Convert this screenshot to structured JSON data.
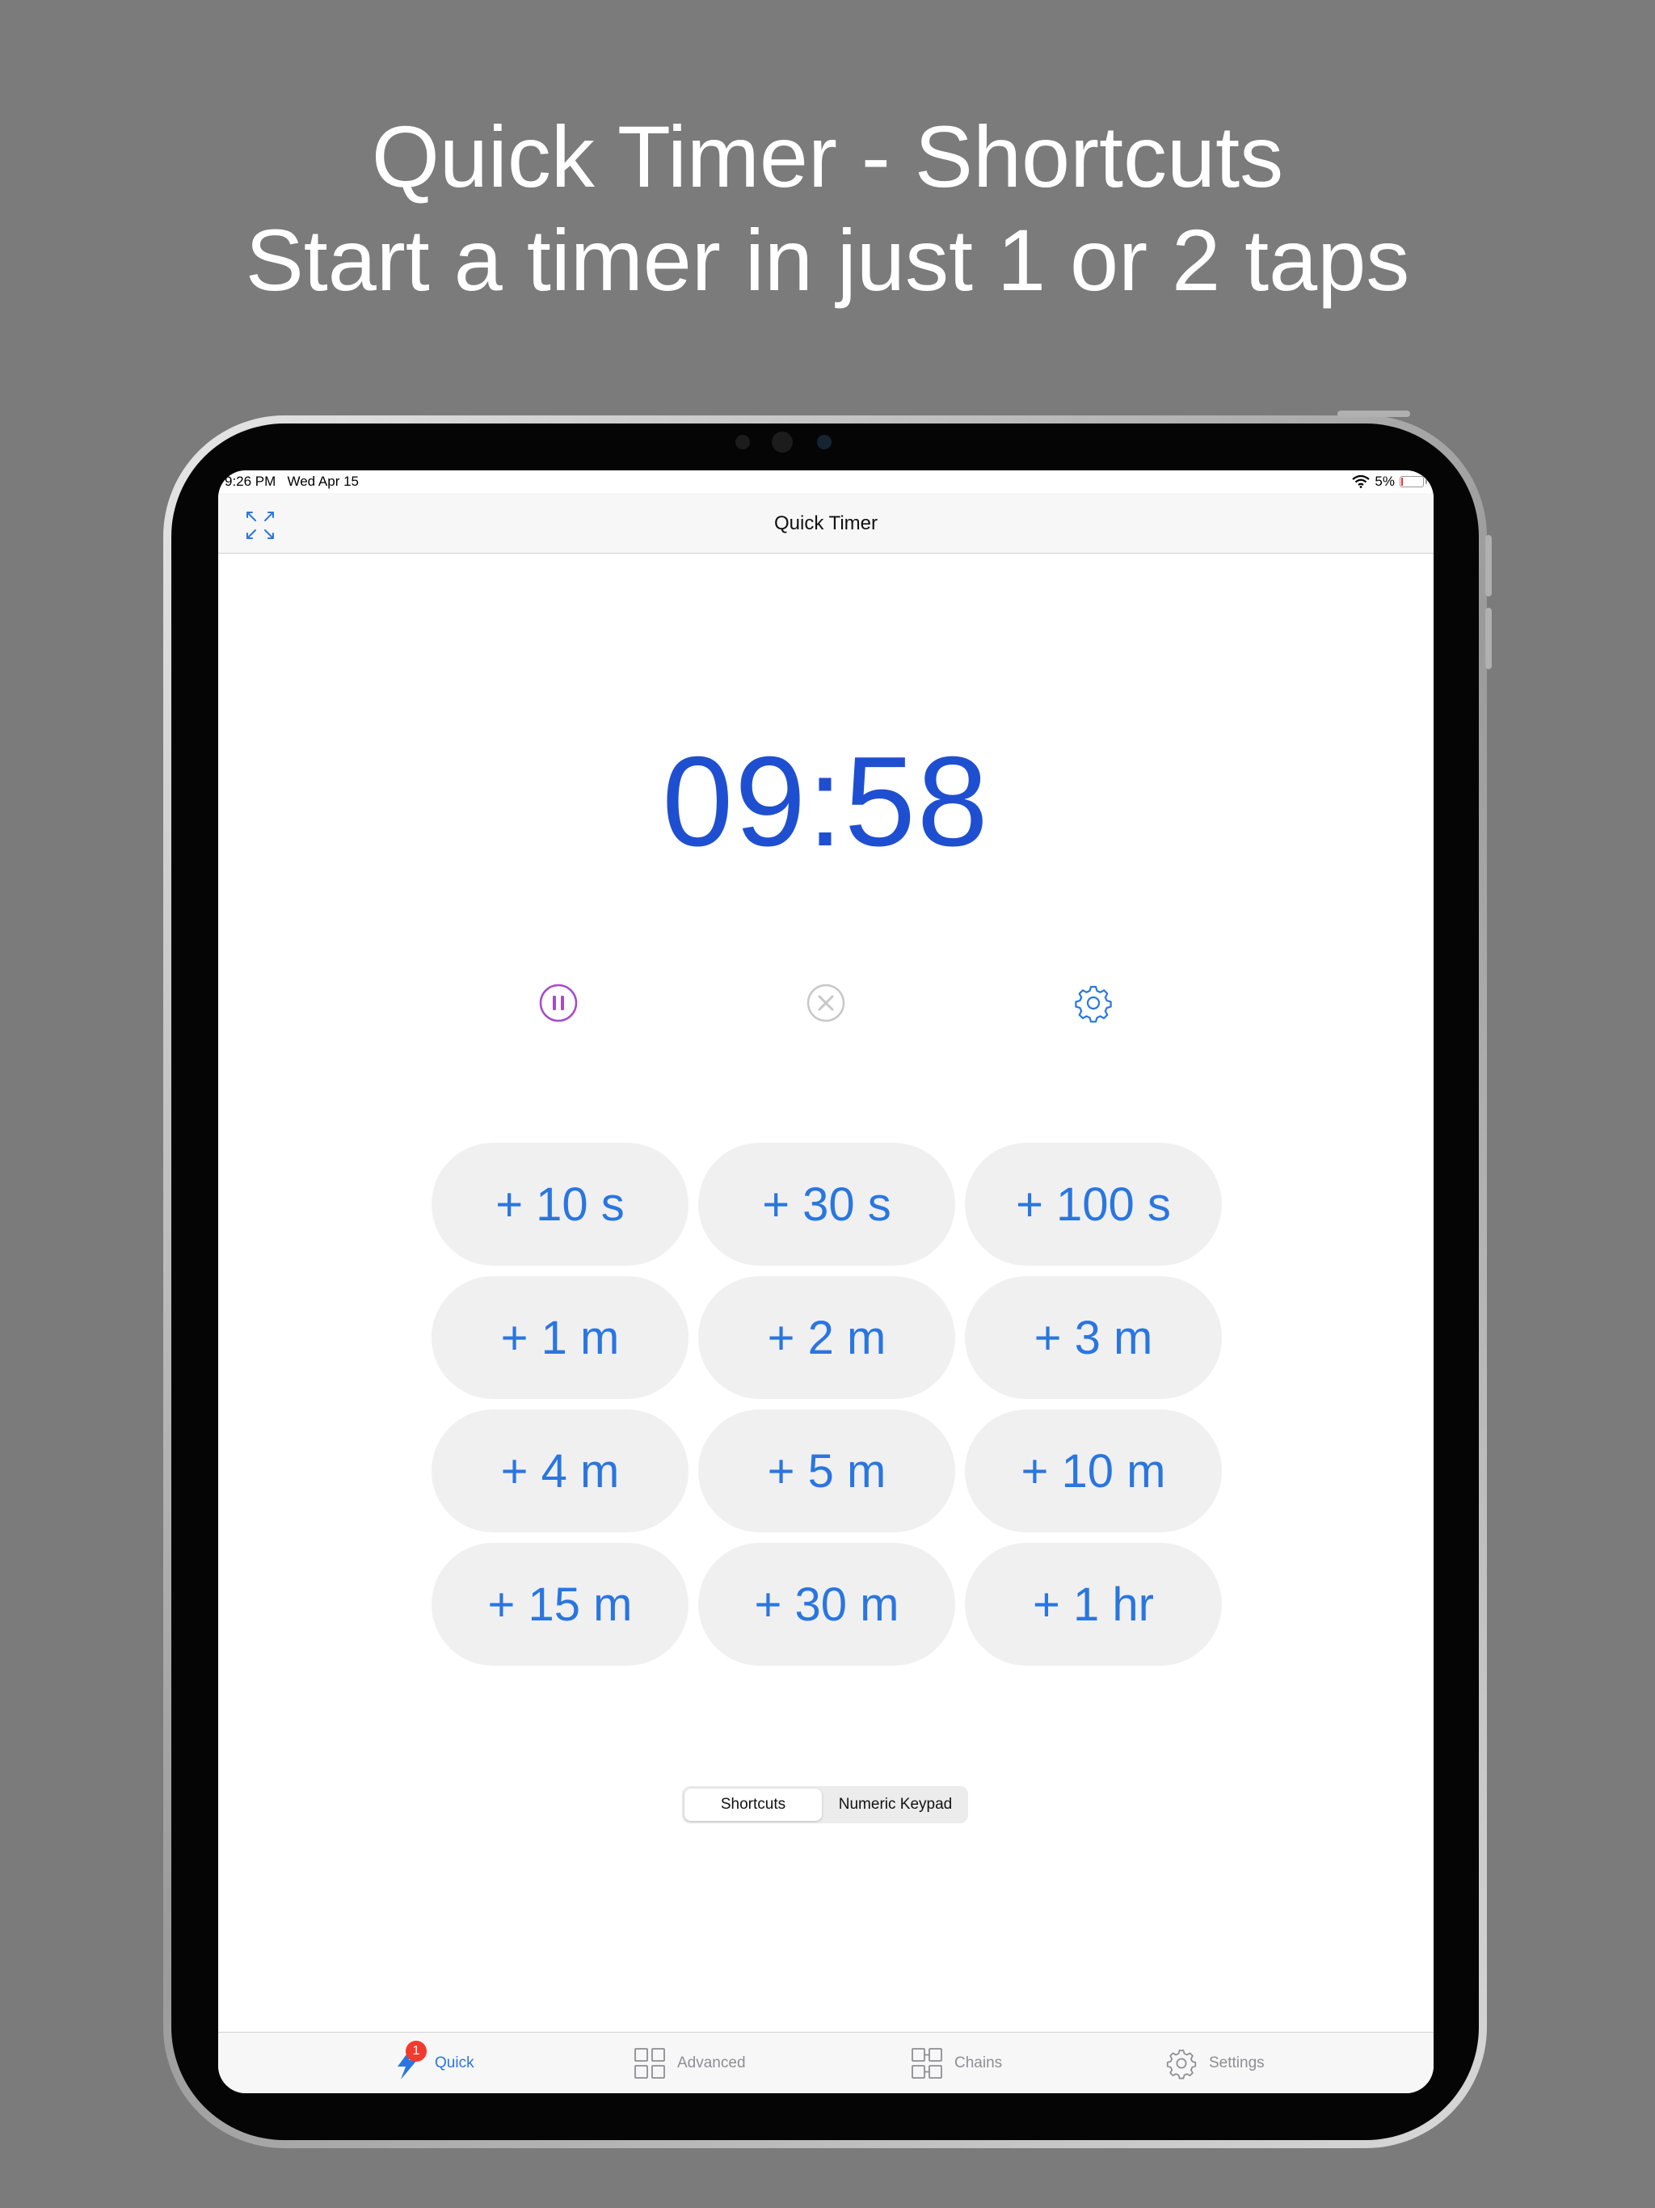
{
  "headline": {
    "line1": "Quick Timer - Shortcuts",
    "line2": "Start a timer in just 1 or 2 taps"
  },
  "status_bar": {
    "time": "9:26 PM",
    "date": "Wed Apr 15",
    "battery": "5%"
  },
  "nav": {
    "title": "Quick Timer"
  },
  "timer": {
    "display": "09:58"
  },
  "controls": {
    "pause_color": "#a64cc6",
    "cancel_color": "#c8c8c8",
    "settings_color": "#2a76e0"
  },
  "shortcuts": [
    "+ 10 s",
    "+ 30 s",
    "+ 100 s",
    "+ 1 m",
    "+ 2 m",
    "+ 3 m",
    "+ 4 m",
    "+ 5 m",
    "+ 10 m",
    "+ 15 m",
    "+ 30 m",
    "+ 1 hr"
  ],
  "segmented": {
    "selected": "Shortcuts",
    "other": "Numeric Keypad"
  },
  "tabs": {
    "quick": "Quick",
    "quick_badge": "1",
    "advanced": "Advanced",
    "chains": "Chains",
    "settings": "Settings"
  },
  "colors": {
    "accent": "#2a76e0",
    "timer": "#1f4fd1",
    "background": "#7b7b7b"
  }
}
